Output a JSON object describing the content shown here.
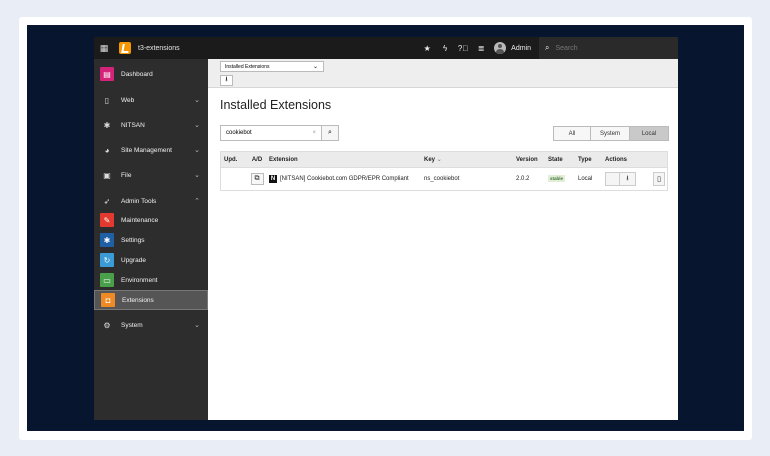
{
  "topbar": {
    "site_name": "t3-extensions",
    "user_name": "Admin",
    "search_placeholder": "Search",
    "icons": [
      "grid-icon",
      "typo3-logo",
      "star-icon",
      "flash-icon",
      "help-icon",
      "list-icon",
      "user-icon",
      "search-icon"
    ]
  },
  "sidebar": {
    "items": [
      {
        "label": "Dashboard",
        "icon": "dashboard-icon",
        "color": "#d6237a"
      },
      {
        "label": "Web",
        "icon": "page-icon"
      },
      {
        "label": "NITSAN",
        "icon": "gear-icon"
      },
      {
        "label": "Site Management",
        "icon": "globe-icon"
      },
      {
        "label": "File",
        "icon": "image-icon"
      },
      {
        "label": "Admin Tools",
        "icon": "rocket-icon"
      },
      {
        "label": "Maintenance",
        "icon": "wrench-icon",
        "color": "#e23a2e"
      },
      {
        "label": "Settings",
        "icon": "settings-icon",
        "color": "#1f5fa5"
      },
      {
        "label": "Upgrade",
        "icon": "refresh-icon",
        "color": "#3a9bd6"
      },
      {
        "label": "Environment",
        "icon": "monitor-icon",
        "color": "#4aa04a"
      },
      {
        "label": "Extensions",
        "icon": "extension-icon",
        "color": "#f08a24"
      },
      {
        "label": "System",
        "icon": "cog-icon"
      }
    ]
  },
  "docheader": {
    "menu_value": "Installed Extensions"
  },
  "main": {
    "title": "Installed Extensions",
    "search_value": "cookiebot",
    "filters": [
      "All",
      "System",
      "Local"
    ],
    "active_filter": "Local"
  },
  "table": {
    "headers": {
      "upd": "Upd.",
      "ad": "A/D",
      "extension": "Extension",
      "key": "Key",
      "version": "Version",
      "state": "State",
      "type": "Type",
      "actions": "Actions"
    },
    "rows": [
      {
        "extension": "[NITSAN] Cookiebot.com GDPR/EPR Compliant",
        "key": "ns_cookiebot",
        "version": "2.0.2",
        "state": "stable",
        "type": "Local"
      }
    ]
  }
}
